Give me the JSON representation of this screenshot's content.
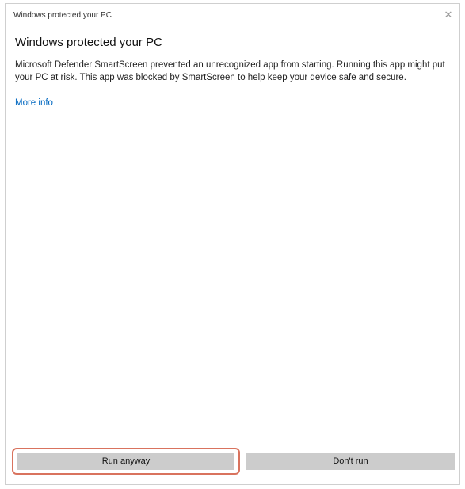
{
  "window": {
    "title": "Windows protected your PC"
  },
  "dialog": {
    "heading": "Windows protected your PC",
    "message": "Microsoft Defender SmartScreen prevented an unrecognized app from starting. Running this app might put your PC at risk. This app was blocked by SmartScreen to help keep your device safe and secure.",
    "more_info_link": "More info"
  },
  "buttons": {
    "primary_label": "Run anyway",
    "secondary_label": "Don't run"
  },
  "icons": {
    "close": "close-icon"
  },
  "colors": {
    "link": "#0067c0",
    "button_bg": "#cccccc",
    "focus_ring": "#d9735e"
  }
}
